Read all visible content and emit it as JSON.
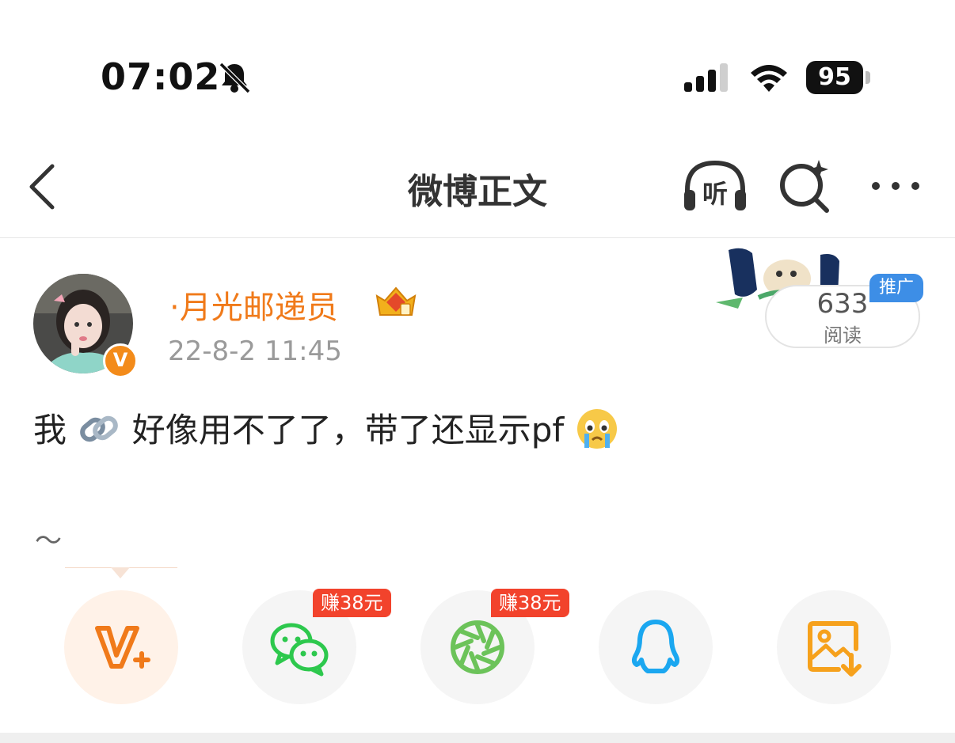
{
  "status_bar": {
    "time": "07:02",
    "battery": "95"
  },
  "nav": {
    "title": "微博正文",
    "listen_label": "听"
  },
  "post": {
    "username": "·月光邮递员",
    "timestamp": "22-8-2 11:45",
    "verified_badge": "V",
    "read_count": "633",
    "read_label": "阅读",
    "ad_tag": "推广",
    "text_before_icon": "我",
    "text_after_icon": "好像用不了了，带了还显示pf",
    "footer_symbol": "～"
  },
  "share": {
    "items": [
      {
        "name": "vplus",
        "icon": "v-plus-icon"
      },
      {
        "name": "wechat",
        "icon": "wechat-icon",
        "badge": "赚38元"
      },
      {
        "name": "moments",
        "icon": "moments-icon",
        "badge": "赚38元"
      },
      {
        "name": "qq",
        "icon": "qq-icon"
      },
      {
        "name": "save-image",
        "icon": "save-image-icon"
      }
    ]
  },
  "colors": {
    "accent": "#f07a1a",
    "badge_red": "#f2432c",
    "ad_blue": "#3d8ee6",
    "wechat_green": "#2dc84d",
    "qq_blue": "#1ba7f0",
    "save_orange": "#f6a11c"
  }
}
